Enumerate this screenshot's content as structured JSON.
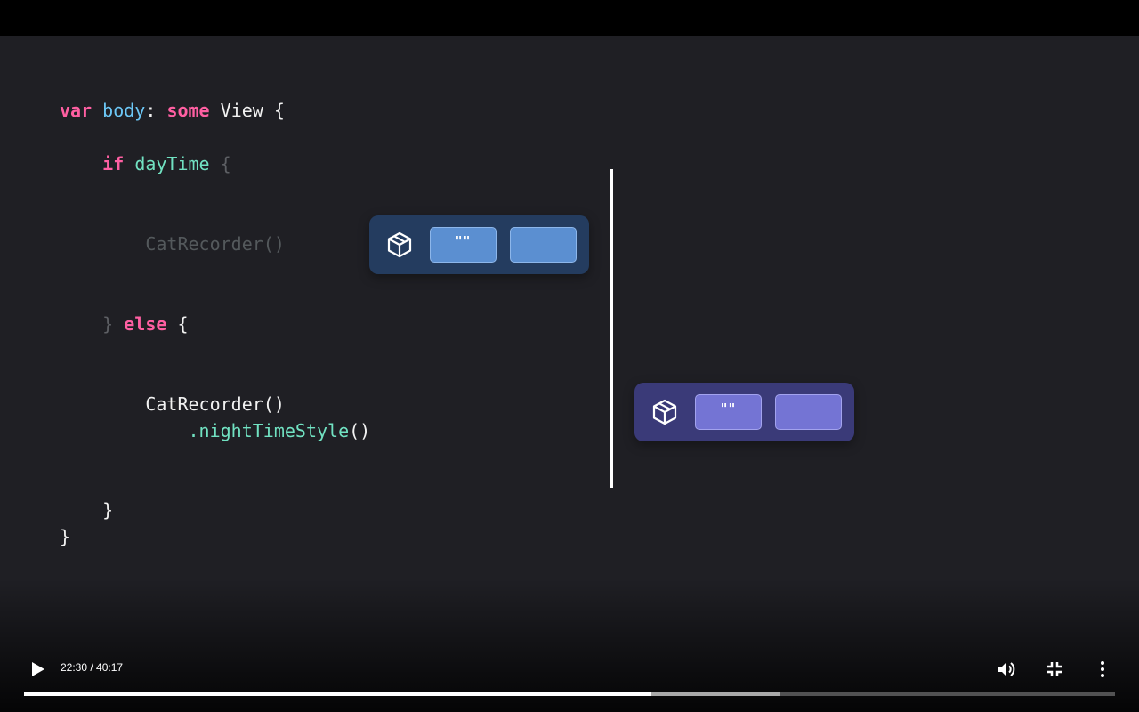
{
  "code": {
    "line1": {
      "kw1": "var",
      "prop": "body",
      "colon": ":",
      "kw2": "some",
      "type": "View",
      "brace": "{"
    },
    "line2": {
      "kw": "if",
      "ident": "dayTime",
      "brace": "{"
    },
    "line3": {
      "text": "CatRecorder()"
    },
    "line4": {
      "close": "}",
      "kw": "else",
      "brace": "{"
    },
    "line5": {
      "text": "CatRecorder()"
    },
    "line6": {
      "dot": ".",
      "ident": "nightTimeStyle",
      "parens": "()"
    },
    "line7": {
      "text": "}"
    },
    "line8": {
      "text": "}"
    }
  },
  "cards": {
    "day": {
      "icon": "package-box-icon",
      "slot1": "\"\"",
      "slot2": "",
      "color": "#243c5f"
    },
    "night": {
      "icon": "package-box-icon",
      "slot1": "\"\"",
      "slot2": "",
      "color": "#3a3a78"
    }
  },
  "player": {
    "time": "22:30 / 40:17",
    "progress_played": 0.5754,
    "progress_buffered": 0.6935,
    "icons": {
      "play": "play-icon",
      "volume": "volume-icon",
      "exit_fullscreen": "exit-fullscreen-icon",
      "more": "more-options-icon"
    }
  }
}
